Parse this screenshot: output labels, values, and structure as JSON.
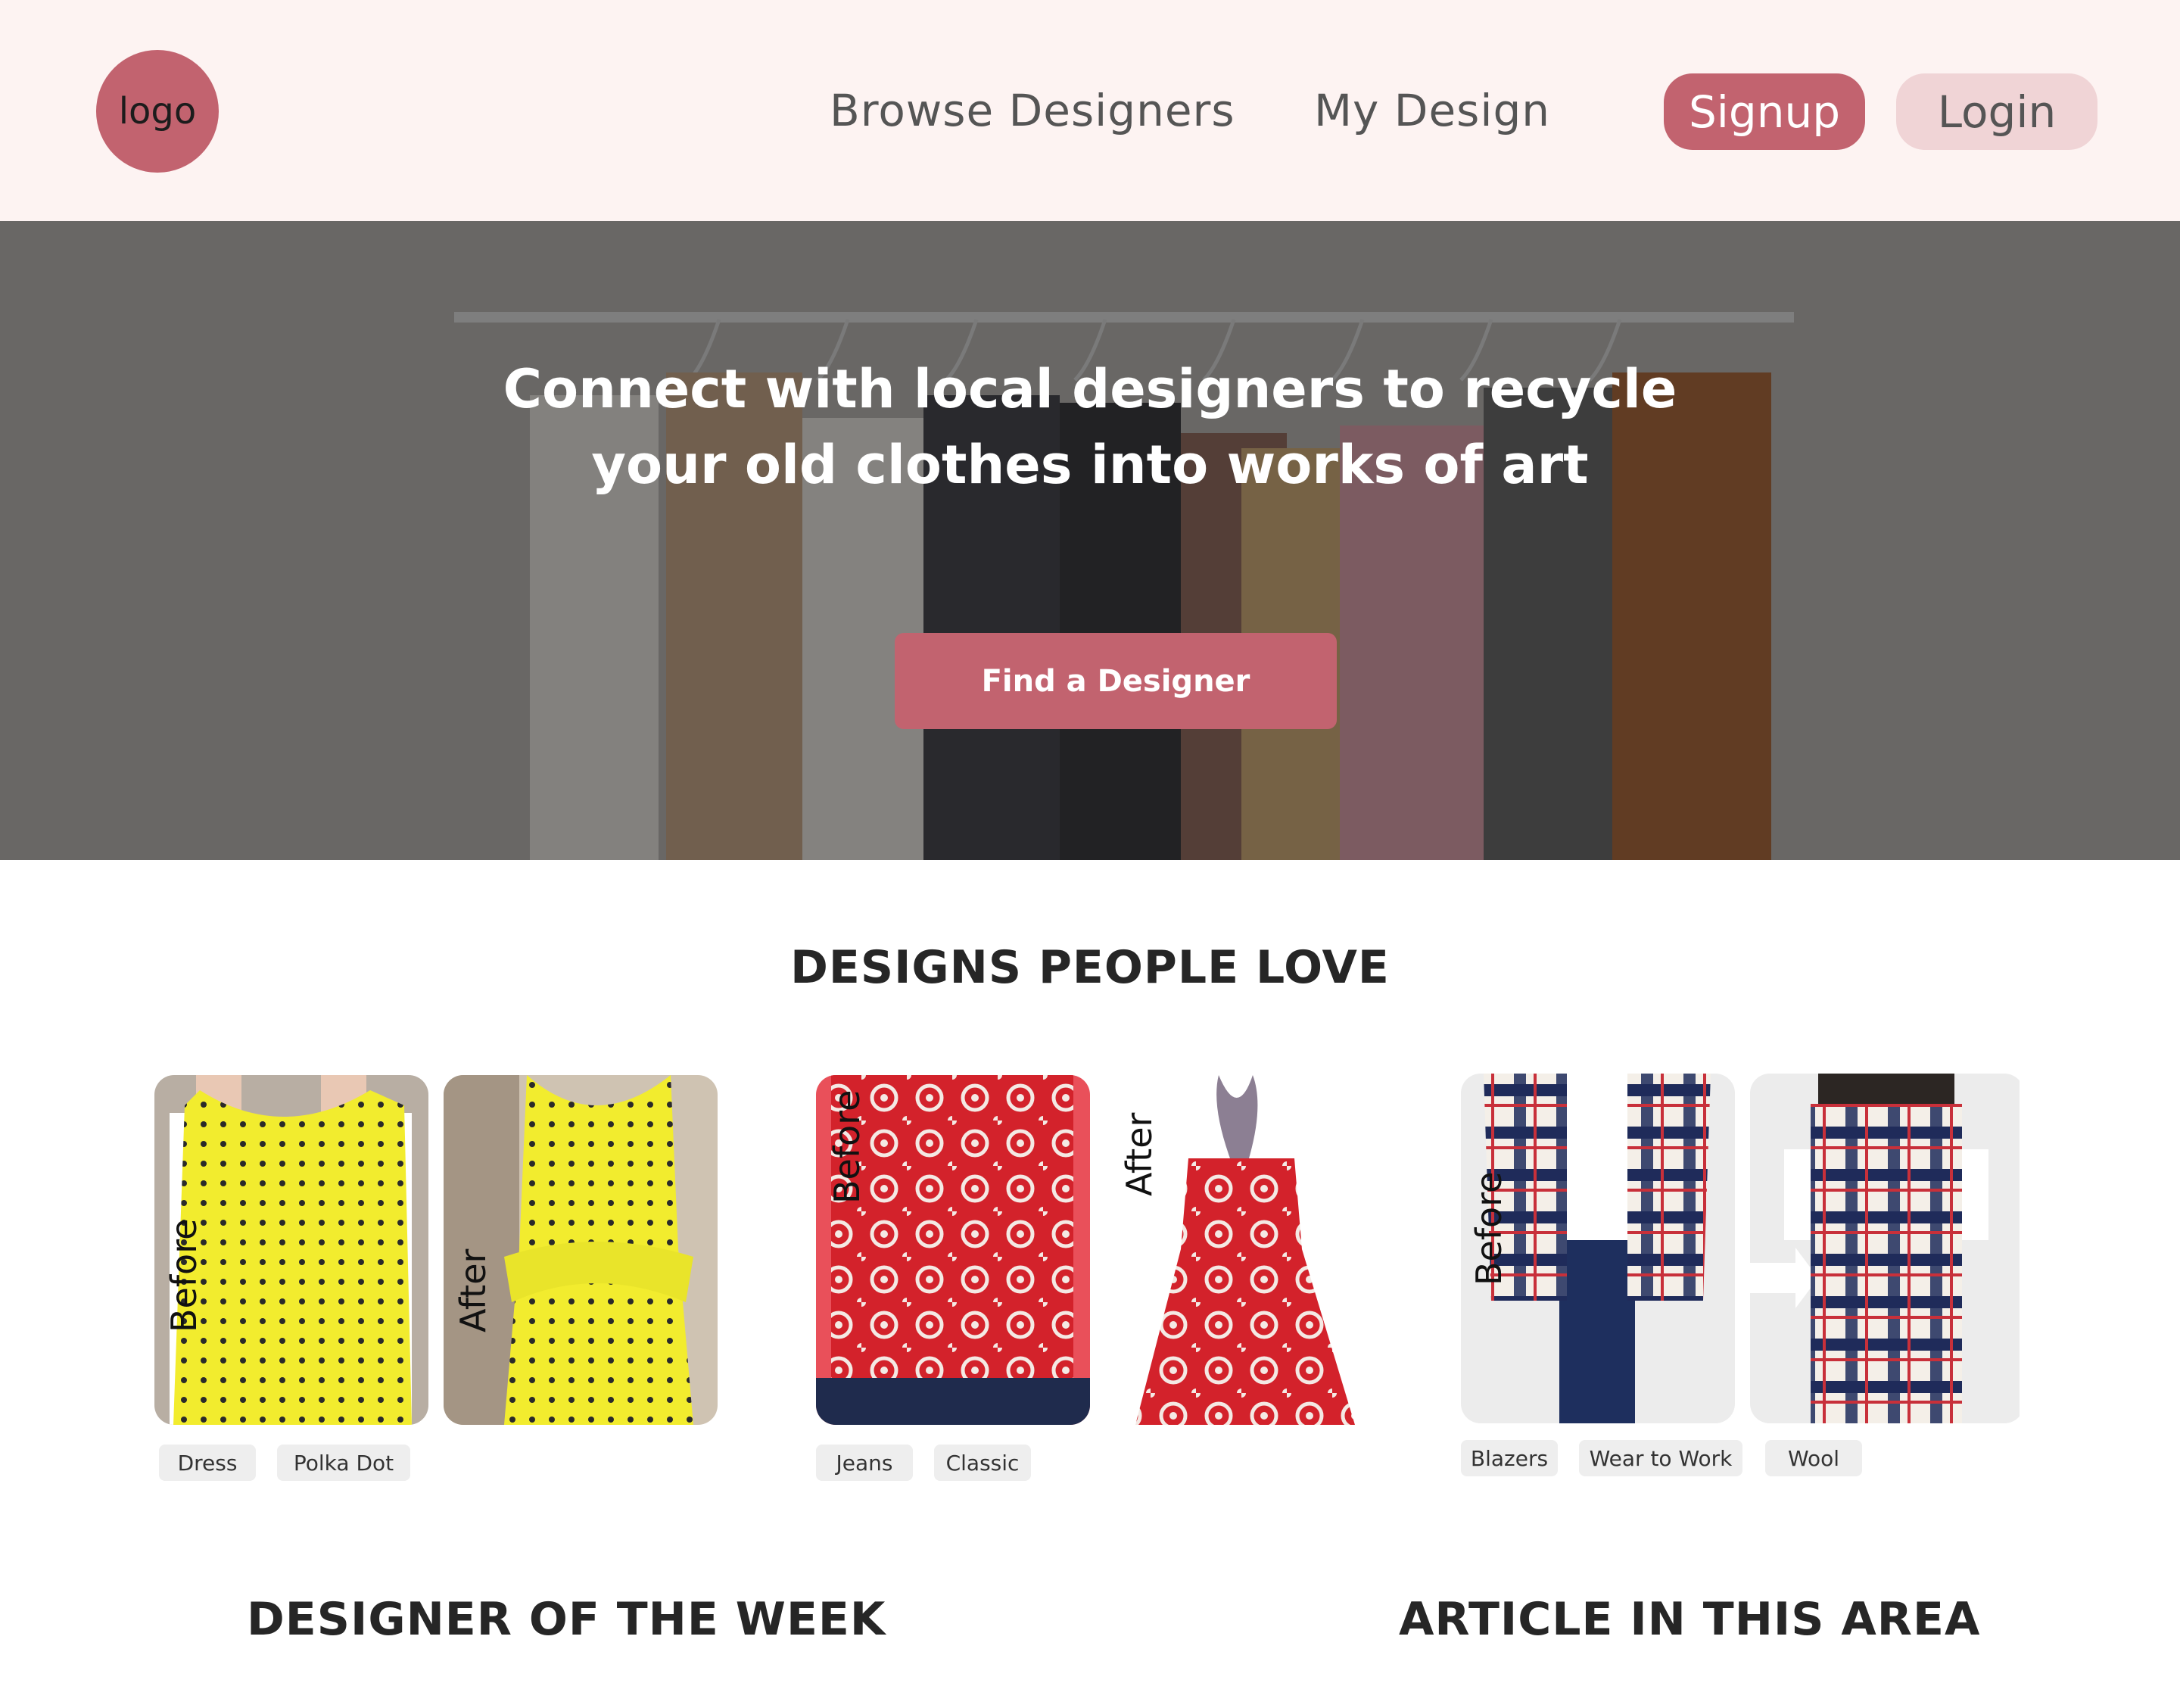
{
  "header": {
    "logo": "logo",
    "nav": {
      "browse": "Browse Designers",
      "my_design": "My Design"
    },
    "signup": "Signup",
    "login": "Login"
  },
  "hero": {
    "title_line1": "Connect with local designers to recycle",
    "title_line2": "your old clothes into works of art",
    "cta": "Find a Designer"
  },
  "designs": {
    "title": "DESIGNS PEOPLE LOVE",
    "cards": [
      {
        "before_label": "Before",
        "after_label": "After",
        "tags": [
          "Dress",
          "Polka Dot"
        ]
      },
      {
        "before_label": "Before",
        "after_label": "After",
        "tags": [
          "Jeans",
          "Classic"
        ]
      },
      {
        "before_label": "Before",
        "tags": [
          "Blazers",
          "Wear to Work",
          "Wool"
        ]
      }
    ]
  },
  "sections": {
    "designer_of_week": "DESIGNER OF THE WEEK",
    "article": "ARTICLE IN THIS AREA"
  },
  "colors": {
    "accent": "#c2636f",
    "accent_light": "#f0d4d6",
    "header_bg": "#fdf3f2"
  }
}
